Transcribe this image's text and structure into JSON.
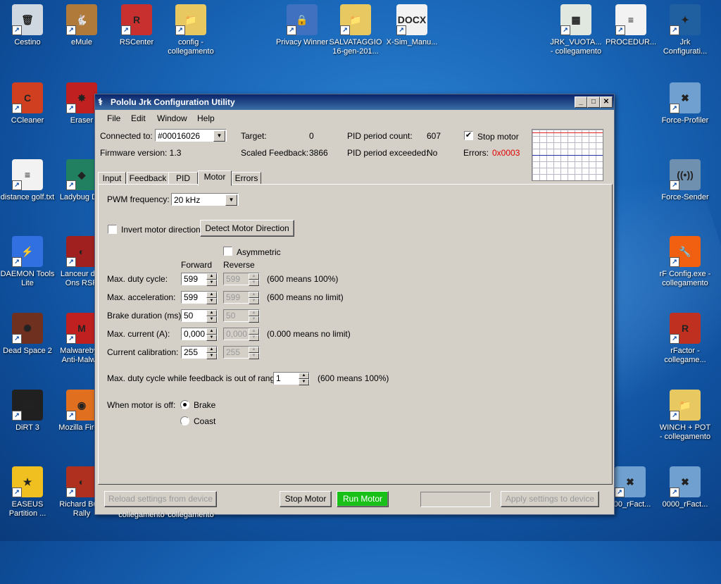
{
  "desktop": {
    "icons": [
      {
        "label": "Cestino",
        "icon": "recycle-bin-icon",
        "color": "#cfd8e0"
      },
      {
        "label": "eMule",
        "icon": "emule-icon",
        "color": "#b07a3a"
      },
      {
        "label": "RSCenter",
        "icon": "rscenter-icon",
        "color": "#c83030"
      },
      {
        "label": "config - collegamento",
        "icon": "folder-icon",
        "color": "#e8c860"
      },
      {
        "label": "Privacy Winner",
        "icon": "lock-icon",
        "color": "#4070c0"
      },
      {
        "label": "SALVATAGGIO 16-gen-201...",
        "icon": "folder-icon",
        "color": "#e8c860"
      },
      {
        "label": "X-Sim_Manu...",
        "icon": "docx-icon",
        "color": "#f2f2f2"
      },
      {
        "label": "JRK_VUOTA... - collegamento",
        "icon": "image-file-icon",
        "color": "#e0e8e0"
      },
      {
        "label": "PROCEDUR...",
        "icon": "document-icon",
        "color": "#f2f2f2"
      },
      {
        "label": "Jrk Configurati...",
        "icon": "jrk-icon",
        "color": "#2060a0"
      },
      {
        "label": "CCleaner",
        "icon": "ccleaner-icon",
        "color": "#d04020"
      },
      {
        "label": "Eraser",
        "icon": "eraser-icon",
        "color": "#c02020"
      },
      {
        "label": "Force-Profiler",
        "icon": "x-sim-icon",
        "color": "#6fa0d0"
      },
      {
        "label": "distance golf.txt",
        "icon": "text-file-icon",
        "color": "#f2f2f2"
      },
      {
        "label": "Ladybug D...",
        "icon": "ladybug-icon",
        "color": "#208060"
      },
      {
        "label": "Force-Sender",
        "icon": "signal-icon",
        "color": "#7090b0"
      },
      {
        "label": "DAEMON Tools Lite",
        "icon": "daemon-tools-icon",
        "color": "#3070e0"
      },
      {
        "label": "Lanceur d'... Ons RSR",
        "icon": "helmet-icon",
        "color": "#a02020"
      },
      {
        "label": "rF Config.exe - collegamento",
        "icon": "wrench-icon",
        "color": "#f06010"
      },
      {
        "label": "Dead Space 2",
        "icon": "dead-space-icon",
        "color": "#703020"
      },
      {
        "label": "Malwareby... Anti-Malw...",
        "icon": "malwarebytes-icon",
        "color": "#c02020"
      },
      {
        "label": "rFactor - collegame...",
        "icon": "rfactor-icon",
        "color": "#c03020"
      },
      {
        "label": "DiRT 3",
        "icon": "dirt3-icon",
        "color": "#202020"
      },
      {
        "label": "Mozilla Fire...",
        "icon": "firefox-icon",
        "color": "#e07020"
      },
      {
        "label": "WINCH + POT - collegamento",
        "icon": "folder-icon",
        "color": "#e8c860"
      },
      {
        "label": "EASEUS Partition ...",
        "icon": "star-icon",
        "color": "#f0c020"
      },
      {
        "label": "Richard Bu... Rally",
        "icon": "helmet-icon",
        "color": "#b03020"
      },
      {
        "label": "000_rFact...",
        "icon": "x-sim-icon",
        "color": "#6fa0d0"
      },
      {
        "label": "0000_rFact...",
        "icon": "x-sim-icon",
        "color": "#6fa0d0"
      }
    ],
    "hidden_labels": [
      "collegamento",
      "collegamento"
    ]
  },
  "window": {
    "title": "Pololu Jrk Configuration Utility",
    "app_icon": "jrk-icon",
    "menu": [
      "File",
      "Edit",
      "Window",
      "Help"
    ],
    "status": {
      "connected_label": "Connected to:",
      "device": "#00016026",
      "firmware_label": "Firmware version: 1.3",
      "target_label": "Target:",
      "target_value": "0",
      "scaled_label": "Scaled Feedback:",
      "scaled_value": "3866",
      "pid_count_label": "PID period count:",
      "pid_count_value": "607",
      "pid_exceeded_label": "PID period exceeded:",
      "pid_exceeded_value": "No",
      "stop_motor_label": "Stop motor",
      "stop_motor_checked": true,
      "errors_label": "Errors:",
      "errors_value": "0x0003",
      "errors_color": "#e00000"
    },
    "tabs": [
      "Input",
      "Feedback",
      "PID",
      "Motor",
      "Errors"
    ],
    "active_tab": "Motor",
    "motor": {
      "pwm_label": "PWM frequency:",
      "pwm_value": "20 kHz",
      "invert_label": "Invert motor direction",
      "detect_button": "Detect Motor Direction",
      "asymmetric_label": "Asymmetric",
      "forward_header": "Forward",
      "reverse_header": "Reverse",
      "rows": [
        {
          "label": "Max. duty cycle:",
          "forward": "599",
          "reverse": "599",
          "note": "(600 means 100%)"
        },
        {
          "label": "Max. acceleration:",
          "forward": "599",
          "reverse": "599",
          "note": "(600 means no limit)"
        },
        {
          "label": "Brake duration (ms):",
          "forward": "50",
          "reverse": "50",
          "note": ""
        },
        {
          "label": "Max. current (A):",
          "forward": "0,000",
          "reverse": "0,000",
          "note": "(0.000 means no limit)"
        },
        {
          "label": "Current calibration:",
          "forward": "255",
          "reverse": "255",
          "note": ""
        }
      ],
      "oor_label": "Max. duty cycle while feedback is out of range:",
      "oor_value": "1",
      "oor_note": "(600 means 100%)",
      "off_label": "When motor is off:",
      "brake_label": "Brake",
      "coast_label": "Coast",
      "selected_off_mode": "Brake"
    },
    "footer": {
      "reload_button": "Reload settings from device",
      "stop_button": "Stop Motor",
      "run_button": "Run Motor",
      "run_color": "#18c018",
      "apply_button": "Apply settings to device"
    }
  }
}
